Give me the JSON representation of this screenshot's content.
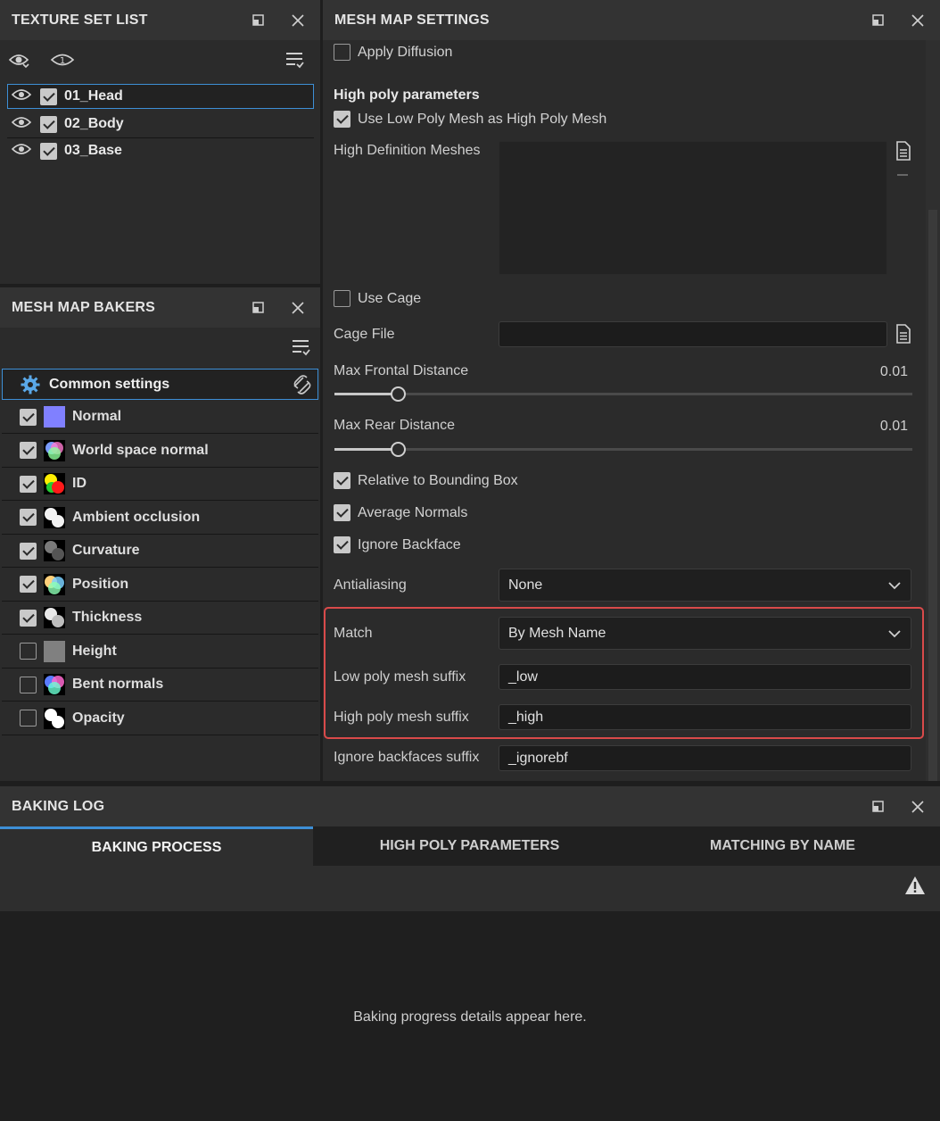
{
  "texture_set_list": {
    "title": "TEXTURE SET LIST",
    "items": [
      {
        "label": "01_Head",
        "checked": true,
        "selected": true
      },
      {
        "label": "02_Body",
        "checked": true,
        "selected": false
      },
      {
        "label": "03_Base",
        "checked": true,
        "selected": false
      }
    ]
  },
  "mesh_map_bakers": {
    "title": "MESH MAP BAKERS",
    "common_settings": "Common settings",
    "bakers": [
      {
        "label": "Normal",
        "checked": true,
        "thumb": "normal"
      },
      {
        "label": "World space normal",
        "checked": true,
        "thumb": "wsn"
      },
      {
        "label": "ID",
        "checked": true,
        "thumb": "id"
      },
      {
        "label": "Ambient occlusion",
        "checked": true,
        "thumb": "ao"
      },
      {
        "label": "Curvature",
        "checked": true,
        "thumb": "curv"
      },
      {
        "label": "Position",
        "checked": true,
        "thumb": "pos"
      },
      {
        "label": "Thickness",
        "checked": true,
        "thumb": "thick"
      },
      {
        "label": "Height",
        "checked": false,
        "thumb": "height"
      },
      {
        "label": "Bent normals",
        "checked": false,
        "thumb": "bent"
      },
      {
        "label": "Opacity",
        "checked": false,
        "thumb": "opacity"
      }
    ]
  },
  "mesh_map_settings": {
    "title": "MESH MAP SETTINGS",
    "apply_diffusion": {
      "label": "Apply Diffusion",
      "checked": false
    },
    "high_poly_header": "High poly parameters",
    "use_low_poly": {
      "label": "Use Low Poly Mesh as High Poly Mesh",
      "checked": true
    },
    "hd_meshes_label": "High Definition Meshes",
    "use_cage": {
      "label": "Use Cage",
      "checked": false
    },
    "cage_file_label": "Cage File",
    "cage_file_value": "",
    "max_frontal": {
      "label": "Max Frontal Distance",
      "value": "0.01",
      "fraction": 0.11
    },
    "max_rear": {
      "label": "Max Rear Distance",
      "value": "0.01",
      "fraction": 0.11
    },
    "relative_bbox": {
      "label": "Relative to Bounding Box",
      "checked": true
    },
    "average_normals": {
      "label": "Average Normals",
      "checked": true
    },
    "ignore_backface": {
      "label": "Ignore Backface",
      "checked": true
    },
    "antialiasing": {
      "label": "Antialiasing",
      "value": "None"
    },
    "match": {
      "label": "Match",
      "value": "By Mesh Name"
    },
    "low_suffix": {
      "label": "Low poly mesh suffix",
      "value": "_low"
    },
    "high_suffix": {
      "label": "High poly mesh suffix",
      "value": "_high"
    },
    "ignore_suffix": {
      "label": "Ignore backfaces suffix",
      "value": "_ignorebf"
    }
  },
  "baking_log": {
    "title": "BAKING LOG",
    "tabs": [
      "BAKING PROCESS",
      "HIGH POLY PARAMETERS",
      "MATCHING BY NAME"
    ],
    "active_tab": 0,
    "message": "Baking progress details appear here."
  },
  "colors": {
    "accent": "#3d8fd6",
    "highlight": "#d94a4a"
  }
}
